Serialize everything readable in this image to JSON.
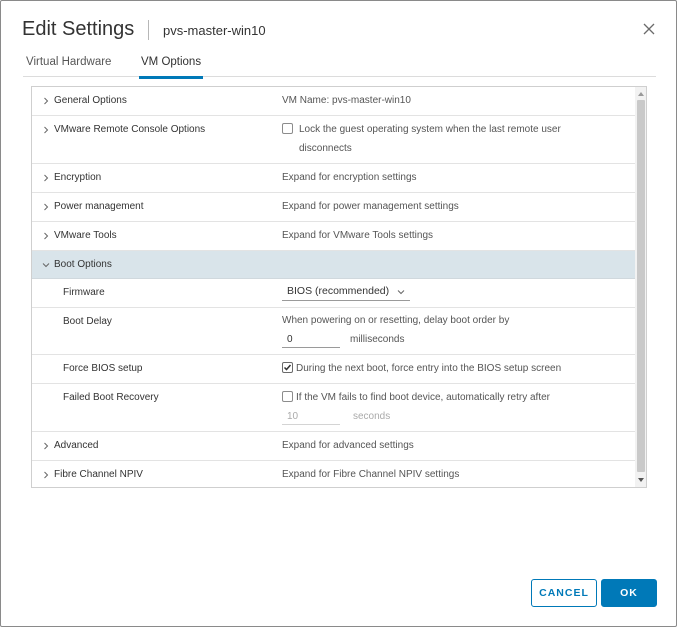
{
  "dialog": {
    "title": "Edit Settings",
    "subtitle": "pvs-master-win10",
    "close_icon": "close-icon"
  },
  "tabs": [
    {
      "label": "Virtual Hardware",
      "active": false
    },
    {
      "label": "VM Options",
      "active": true
    }
  ],
  "sections": {
    "general": {
      "label": "General Options",
      "value": "VM Name: pvs-master-win10"
    },
    "vmrc": {
      "label": "VMware Remote Console Options",
      "checkbox_text_1": "Lock the guest operating system when the last remote user",
      "checkbox_text_2": "disconnects",
      "checked": false
    },
    "encryption": {
      "label": "Encryption",
      "value": "Expand for encryption settings"
    },
    "power": {
      "label": "Power management",
      "value": "Expand for power management settings"
    },
    "tools": {
      "label": "VMware Tools",
      "value": "Expand for VMware Tools settings"
    },
    "boot": {
      "label": "Boot Options",
      "firmware_label": "Firmware",
      "firmware_value": "BIOS (recommended)",
      "delay_label": "Boot Delay",
      "delay_text": "When powering on or resetting, delay boot order by",
      "delay_value": "0",
      "delay_unit": "milliseconds",
      "force_bios_label": "Force BIOS setup",
      "force_bios_text": "During the next boot, force entry into the BIOS setup screen",
      "force_bios_checked": true,
      "failed_label": "Failed Boot Recovery",
      "failed_text": "If the VM fails to find boot device, automatically retry after",
      "failed_checked": false,
      "failed_value": "10",
      "failed_unit": "seconds"
    },
    "advanced": {
      "label": "Advanced",
      "value": "Expand for advanced settings"
    },
    "npiv": {
      "label": "Fibre Channel NPIV",
      "value": "Expand for Fibre Channel NPIV settings"
    }
  },
  "buttons": {
    "cancel": "CANCEL",
    "ok": "OK"
  },
  "colors": {
    "accent": "#0079b8",
    "expanded_row": "#d9e4ea"
  }
}
